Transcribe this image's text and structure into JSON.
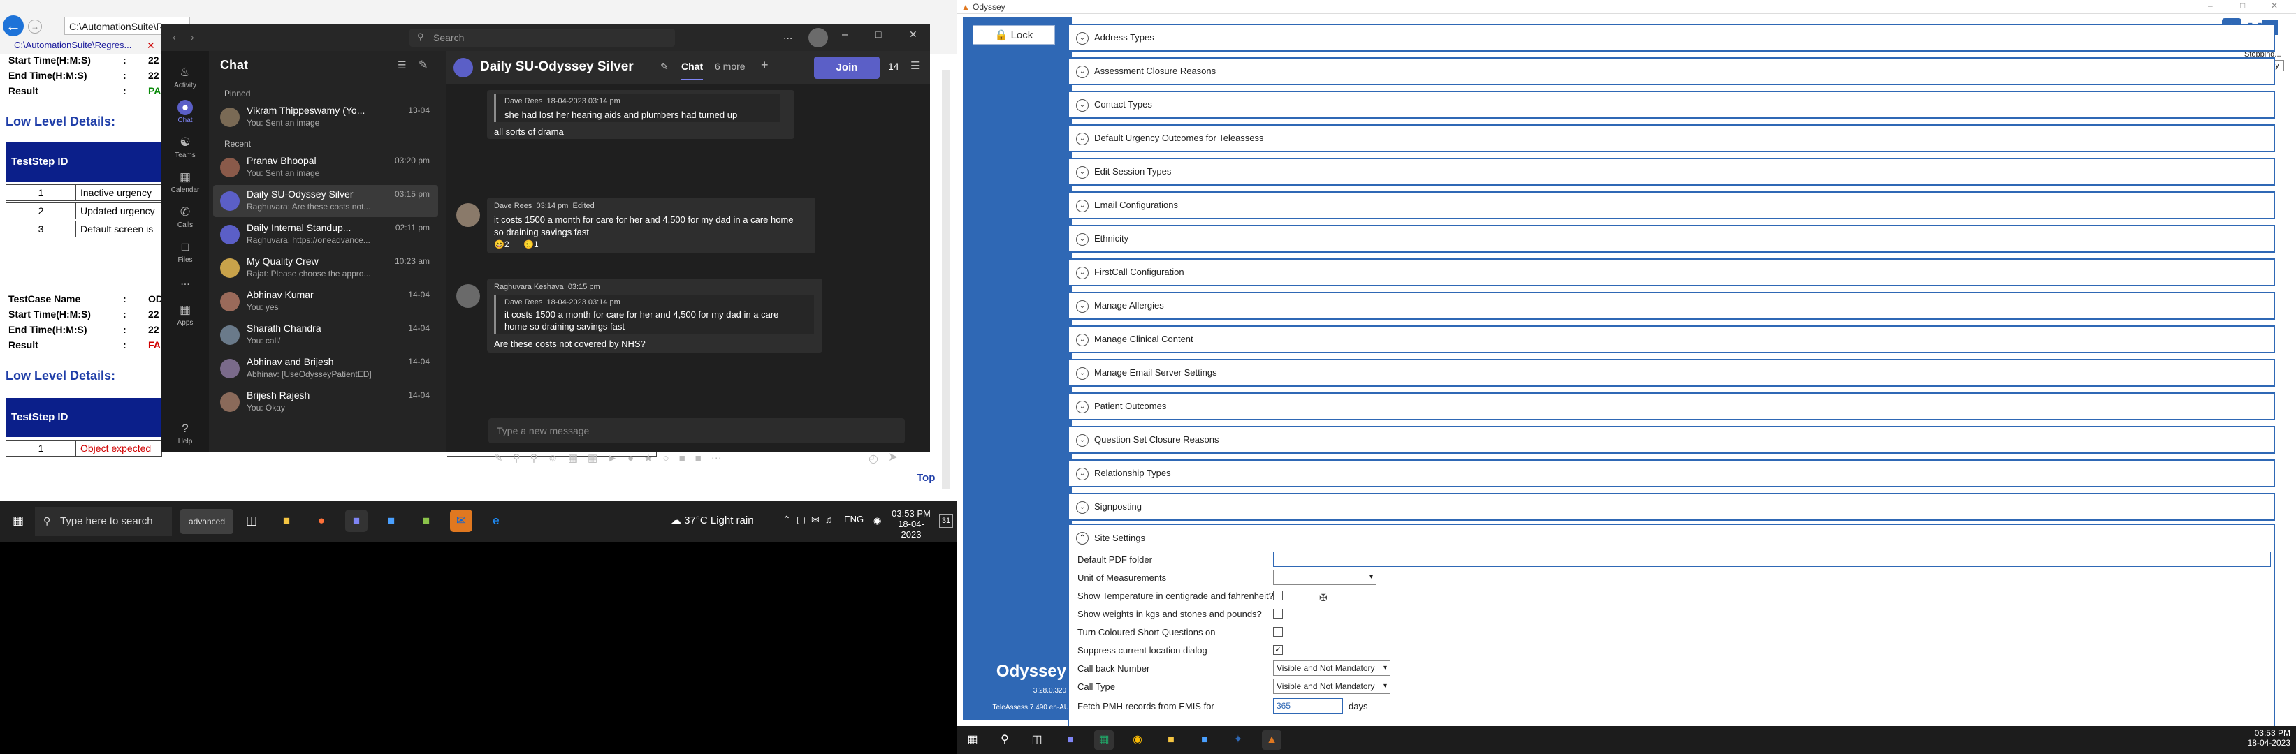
{
  "report": {
    "tab_title": "C:\\AutomationSuite\\Regres...",
    "address": "C:\\AutomationSuite\\Regr",
    "tc1": {
      "start_label": "Start Time(H:M:S)",
      "start_value": "22",
      "end_label": "End Time(H:M:S)",
      "end_value": "22",
      "result_label": "Result",
      "result_value": "PA"
    },
    "low_level": "Low Level Details:",
    "teststep_header": "TestStep ID",
    "steps1": [
      {
        "id": "1",
        "text": "Inactive urgency"
      },
      {
        "id": "2",
        "text": "Updated urgency"
      },
      {
        "id": "3",
        "text": "Default screen is"
      }
    ],
    "tc2": {
      "name_label": "TestCase Name",
      "name_value": "OD",
      "start_label": "Start Time(H:M:S)",
      "start_value": "22",
      "end_label": "End Time(H:M:S)",
      "end_value": "22",
      "result_label": "Result",
      "result_value": "FA"
    },
    "steps2": [
      {
        "id": "1",
        "text": "Object expected"
      }
    ],
    "colon": ":",
    "top_link": "Top"
  },
  "teams": {
    "search_placeholder": "Search",
    "rail": [
      {
        "label": "Activity",
        "icon": "bell-icon"
      },
      {
        "label": "Chat",
        "icon": "chat-icon"
      },
      {
        "label": "Teams",
        "icon": "teams-icon"
      },
      {
        "label": "Calendar",
        "icon": "calendar-icon"
      },
      {
        "label": "Calls",
        "icon": "phone-icon"
      },
      {
        "label": "Files",
        "icon": "file-icon"
      },
      {
        "label": "Apps",
        "icon": "apps-icon"
      },
      {
        "label": "Help",
        "icon": "help-icon"
      }
    ],
    "more": "...",
    "list_title": "Chat",
    "pinned_label": "Pinned",
    "recent_label": "Recent",
    "chats": [
      {
        "name": "Vikram Thippeswamy (Yo...",
        "preview": "You: Sent an image",
        "time": "13-04",
        "color": "#7a6a55"
      },
      {
        "name": "Pranav Bhoopal",
        "preview": "You: Sent an image",
        "time": "03:20 pm",
        "color": "#8a5a4a"
      },
      {
        "name": "Daily SU-Odyssey Silver",
        "preview": "Raghuvara: Are these costs not...",
        "time": "03:15 pm",
        "color": "#5b5fc7"
      },
      {
        "name": "Daily Internal Standup...",
        "preview": "Raghuvara: https://oneadvance...",
        "time": "02:11 pm",
        "color": "#5b5fc7"
      },
      {
        "name": "My Quality Crew",
        "preview": "Rajat: Please choose the appro...",
        "time": "10:23 am",
        "color": "#c8a24a"
      },
      {
        "name": "Abhinav Kumar",
        "preview": "You: yes",
        "time": "14-04",
        "color": "#9a6a5a"
      },
      {
        "name": "Sharath Chandra",
        "preview": "You: call/",
        "time": "14-04",
        "color": "#6a7a8a"
      },
      {
        "name": "Abhinav and Brijesh",
        "preview": "Abhinav: [UseOdysseyPatientED]",
        "time": "14-04",
        "color": "#7a6a8a"
      },
      {
        "name": "Brijesh Rajesh",
        "preview": "You: Okay",
        "time": "14-04",
        "color": "#8a6a5a"
      }
    ],
    "channel": {
      "title": "Daily SU-Odyssey Silver",
      "tab_chat": "Chat",
      "tab_more": "6 more",
      "join": "Join",
      "participants": "14"
    },
    "messages": {
      "q1_author": "Dave Rees",
      "q1_time": "18-04-2023 03:14 pm",
      "q1_text": "she had lost her hearing aids and plumbers had turned up",
      "m0": "all sorts of drama",
      "m1_author": "Dave Rees",
      "m1_time": "03:14 pm",
      "m1_edited": "Edited",
      "m1_text1": "it costs 1500 a month for care for her and 4,500 for my dad in a care home",
      "m1_text2": "so draining savings fast",
      "r1": "2",
      "r2": "1",
      "m2_author": "Raghuvara Keshava",
      "m2_time": "03:15 pm",
      "q2_author": "Dave Rees",
      "q2_time": "18-04-2023 03:14 pm",
      "q2_text1": "it costs 1500 a month for care for her and 4,500 for my dad in a care",
      "q2_text2": "home so draining savings fast",
      "m2_text": "Are these costs not covered by NHS?"
    },
    "compose_placeholder": "Type a new message"
  },
  "taskbar1": {
    "search": "Type here to search",
    "advanced": "advanced",
    "weather": "37°C  Light rain",
    "lang": "ENG",
    "time": "03:53 PM",
    "date": "18-04-2023",
    "badge": "31"
  },
  "odyssey": {
    "window_title": "Odyssey",
    "lock_label": "Lock",
    "brand": "Odyssey",
    "version": "3.28.0.320",
    "teleassess": "TeleAssess 7.490 en-AU",
    "stopping": "Stopping...",
    "tooltip": "Odyssey",
    "sections": [
      "Address Types",
      "Assessment Closure Reasons",
      "Contact Types",
      "Default Urgency Outcomes for Teleassess",
      "Edit Session Types",
      "Email Configurations",
      "Ethnicity",
      "FirstCall Configuration",
      "Manage Allergies",
      "Manage Clinical Content",
      "Manage Email Server Settings",
      "Patient Outcomes",
      "Question Set Closure Reasons",
      "Relationship Types",
      "Signposting"
    ],
    "site": {
      "title": "Site Settings",
      "pdf_label": "Default PDF folder",
      "pdf_value": "",
      "uom_label": "Unit of Measurements",
      "uom_value": "",
      "temp_label": "Show Temperature in centigrade and fahrenheit?",
      "weights_label": "Show weights in kgs and stones and pounds?",
      "coloured_label": "Turn Coloured Short Questions on",
      "suppress_label": "Suppress current location dialog",
      "callback_label": "Call back Number",
      "callback_value": "Visible and Not Mandatory",
      "calltype_label": "Call Type",
      "calltype_value": "Visible and Not Mandatory",
      "pmh_label": "Fetch PMH records from EMIS for",
      "pmh_value": "365",
      "pmh_unit": "days"
    }
  },
  "taskbar2": {
    "time": "03:53 PM",
    "date": "18-04-2023"
  }
}
